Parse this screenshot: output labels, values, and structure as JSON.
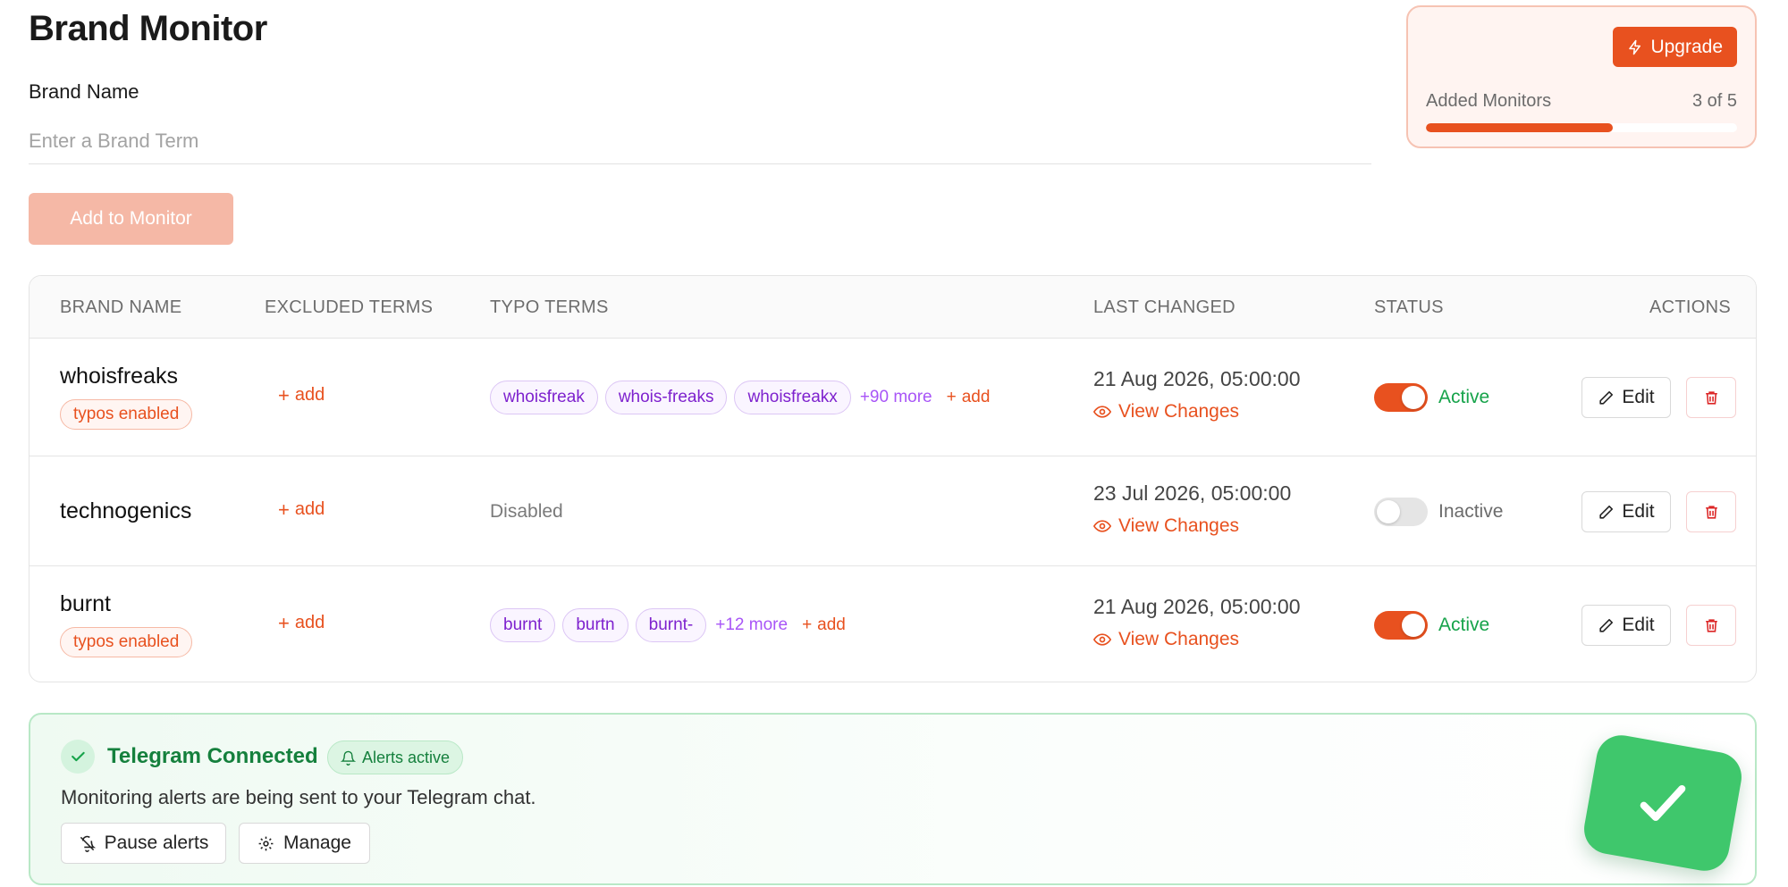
{
  "page": {
    "title": "Brand Monitor",
    "brand_label": "Brand Name",
    "brand_placeholder": "Enter a Brand Term",
    "add_button": "Add to Monitor"
  },
  "plan": {
    "upgrade_label": "Upgrade",
    "monitors_label": "Added Monitors",
    "monitors_count": "3 of 5",
    "monitors_used": 3,
    "monitors_limit": 5,
    "accent": "#e8511f"
  },
  "table": {
    "headers": {
      "brand": "BRAND NAME",
      "excluded": "EXCLUDED TERMS",
      "typo": "TYPO TERMS",
      "last_changed": "LAST CHANGED",
      "status": "STATUS",
      "actions": "ACTIONS"
    },
    "rows": [
      {
        "name": "whoisfreaks",
        "badge": "typos enabled",
        "excluded_add": "add",
        "typos": [
          "whoisfreak",
          "whois-freaks",
          "whoisfreakx"
        ],
        "typos_more": "+90 more",
        "typos_add": "add",
        "last_changed": "21 Aug 2026, 05:00:00",
        "view_changes": "View Changes",
        "status": "Active",
        "edit": "Edit"
      },
      {
        "name": "technogenics",
        "excluded_add": "add",
        "typos_disabled": "Disabled",
        "last_changed": "23 Jul 2026, 05:00:00",
        "view_changes": "View Changes",
        "status": "Inactive",
        "edit": "Edit"
      },
      {
        "name": "burnt",
        "badge": "typos enabled",
        "excluded_add": "add",
        "typos": [
          "burnt",
          "burtn",
          "burnt-"
        ],
        "typos_more": "+12 more",
        "typos_add": "add",
        "last_changed": "21 Aug 2026, 05:00:00",
        "view_changes": "View Changes",
        "status": "Active",
        "edit": "Edit"
      }
    ]
  },
  "telegram": {
    "title": "Telegram Connected",
    "badge": "Alerts active",
    "description": "Monitoring alerts are being sent to your Telegram chat.",
    "pause_label": "Pause alerts",
    "manage_label": "Manage",
    "success_color": "#3fc76c"
  }
}
